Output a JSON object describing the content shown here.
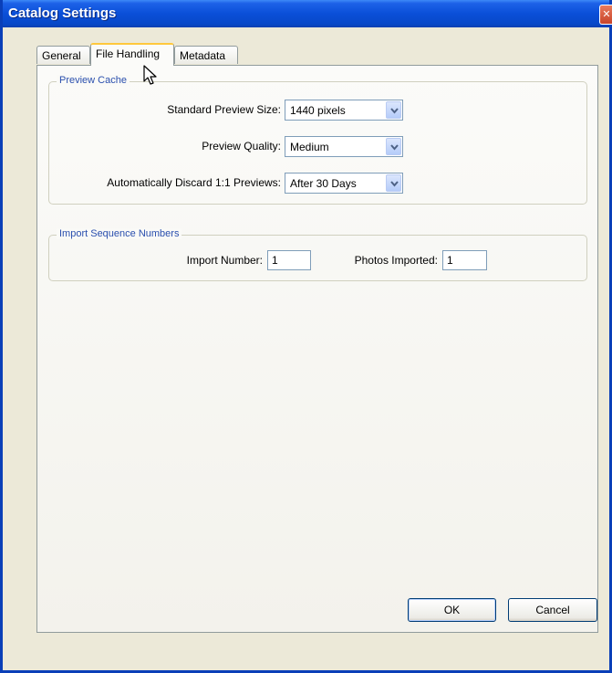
{
  "window": {
    "title": "Catalog Settings",
    "close_glyph": "✕"
  },
  "tabs": [
    {
      "label": "General"
    },
    {
      "label": "File Handling"
    },
    {
      "label": "Metadata"
    }
  ],
  "preview_cache": {
    "legend": "Preview Cache",
    "standard_preview_size": {
      "label": "Standard Preview Size:",
      "value": "1440 pixels"
    },
    "preview_quality": {
      "label": "Preview Quality:",
      "value": "Medium"
    },
    "discard_previews": {
      "label": "Automatically Discard 1:1 Previews:",
      "value": "After 30 Days"
    }
  },
  "import_sequence": {
    "legend": "Import Sequence Numbers",
    "import_number": {
      "label": "Import Number:",
      "value": "1"
    },
    "photos_imported": {
      "label": "Photos Imported:",
      "value": "1"
    }
  },
  "buttons": {
    "ok": "OK",
    "cancel": "Cancel"
  },
  "colors": {
    "titlebar": "#0a4fd8",
    "dialog_bg": "#ece9d8",
    "active_tab_accent": "#ffc83c",
    "legend_text": "#2a4fae"
  },
  "icons": {
    "cursor": "arrow-cursor-icon",
    "dropdown": "chevron-down-icon",
    "close": "close-icon"
  }
}
